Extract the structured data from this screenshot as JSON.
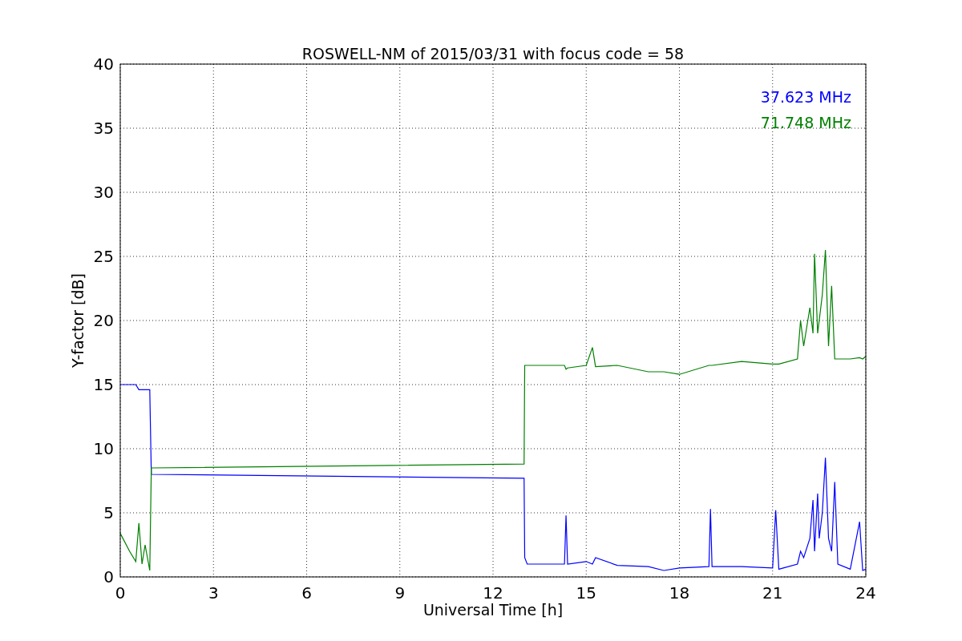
{
  "chart_data": {
    "type": "line",
    "title": "ROSWELL-NM of 2015/03/31 with focus code = 58",
    "xlabel": "Universal Time [h]",
    "ylabel": "Y-factor [dB]",
    "xlim": [
      0,
      24
    ],
    "ylim": [
      0,
      40
    ],
    "xticks": [
      0,
      3,
      6,
      9,
      12,
      15,
      18,
      21,
      24
    ],
    "yticks": [
      0,
      5,
      10,
      15,
      20,
      25,
      30,
      35,
      40
    ],
    "grid": true,
    "x": [
      0,
      0.3,
      0.5,
      0.6,
      0.7,
      0.8,
      0.95,
      1.0,
      13,
      13.02,
      13.1,
      14.3,
      14.35,
      14.4,
      15,
      15.2,
      15.3,
      16,
      17,
      17.5,
      18,
      18.95,
      19,
      19.05,
      20,
      21,
      21.1,
      21.2,
      21.8,
      21.9,
      22,
      22.2,
      22.3,
      22.35,
      22.45,
      22.5,
      22.6,
      22.7,
      22.8,
      22.9,
      23,
      23.1,
      23.5,
      23.8,
      23.9,
      24
    ],
    "series": [
      {
        "name": "37.623 MHz",
        "color": "#0000ff",
        "values": [
          15,
          15,
          15,
          14.6,
          14.6,
          14.6,
          14.6,
          8,
          7.7,
          1.5,
          1,
          1,
          4.8,
          1,
          1.2,
          1,
          1.5,
          0.9,
          0.8,
          0.5,
          0.7,
          0.8,
          5.3,
          0.8,
          0.8,
          0.7,
          5.2,
          0.6,
          1,
          2,
          1.5,
          3,
          6,
          2,
          6.5,
          3,
          5,
          9.3,
          3,
          2,
          7.4,
          1,
          0.6,
          4.3,
          0.5,
          0.6
        ]
      },
      {
        "name": "71.748 MHz",
        "color": "#008000",
        "values": [
          3.4,
          2,
          1.2,
          4.2,
          1,
          2.5,
          0.5,
          8.5,
          8.8,
          16.5,
          16.5,
          16.5,
          16.2,
          16.3,
          16.5,
          17.9,
          16.4,
          16.5,
          16,
          16,
          15.8,
          16.5,
          16.5,
          16.5,
          16.8,
          16.6,
          16.6,
          16.6,
          17,
          20,
          18,
          21,
          19,
          25.2,
          19,
          20,
          22,
          25.5,
          18,
          22.7,
          17,
          17,
          17,
          17.1,
          17,
          17.2
        ]
      }
    ]
  }
}
